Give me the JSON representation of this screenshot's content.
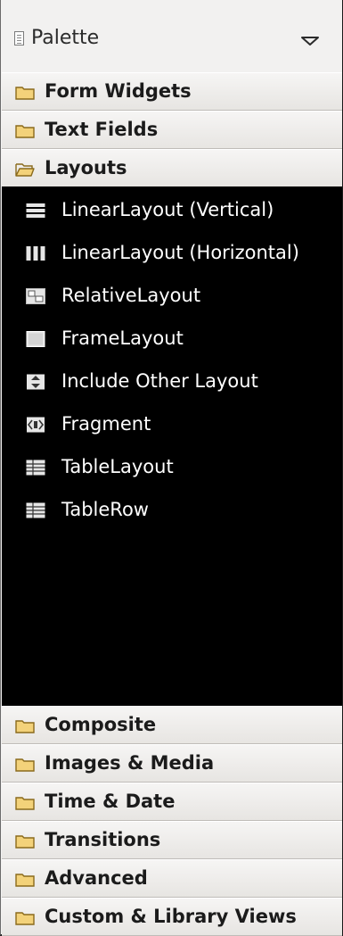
{
  "palette": {
    "title": "Palette",
    "icon": "palette-icon",
    "menu_icon": "triangle-down-icon"
  },
  "categories_top": [
    {
      "label": "Form Widgets",
      "icon": "folder-closed-icon",
      "expanded": false
    },
    {
      "label": "Text Fields",
      "icon": "folder-closed-icon",
      "expanded": false
    },
    {
      "label": "Layouts",
      "icon": "folder-open-icon",
      "expanded": true
    }
  ],
  "layouts_items": [
    {
      "label": "LinearLayout (Vertical)",
      "icon": "linear-layout-vertical-icon"
    },
    {
      "label": "LinearLayout (Horizontal)",
      "icon": "linear-layout-horizontal-icon"
    },
    {
      "label": "RelativeLayout",
      "icon": "relative-layout-icon"
    },
    {
      "label": "FrameLayout",
      "icon": "frame-layout-icon"
    },
    {
      "label": "Include Other Layout",
      "icon": "include-layout-icon"
    },
    {
      "label": "Fragment",
      "icon": "fragment-icon"
    },
    {
      "label": "TableLayout",
      "icon": "table-layout-icon"
    },
    {
      "label": "TableRow",
      "icon": "table-row-icon"
    }
  ],
  "categories_bottom": [
    {
      "label": "Composite",
      "icon": "folder-closed-icon"
    },
    {
      "label": "Images & Media",
      "icon": "folder-closed-icon"
    },
    {
      "label": "Time & Date",
      "icon": "folder-closed-icon"
    },
    {
      "label": "Transitions",
      "icon": "folder-closed-icon"
    },
    {
      "label": "Advanced",
      "icon": "folder-closed-icon"
    },
    {
      "label": "Custom & Library Views",
      "icon": "folder-closed-icon"
    }
  ],
  "colors": {
    "folder_fill": "#f3d27a",
    "folder_stroke": "#8a6a1c",
    "list_background": "#000000",
    "list_text": "#ffffff"
  }
}
